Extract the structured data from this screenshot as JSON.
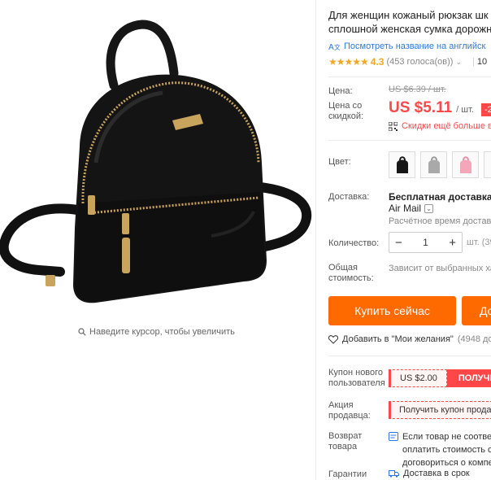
{
  "product": {
    "title_line1": "Для женщин кожаный рюкзак шк",
    "title_line2": "сплошной женская сумка дорожн",
    "translate_link": "Посмотреть название на английск",
    "rating_value": "4.3",
    "votes": "(453 голоса(ов))",
    "orders_count": "10"
  },
  "image": {
    "zoom_hint": "Наведите курсор, чтобы увеличить"
  },
  "price": {
    "label": "Цена:",
    "old_price": "US $6.39 / шт.",
    "discount_label": "Цена со скидкой:",
    "current_price": "US $5.11",
    "unit": "/ шт.",
    "discount_badge": "-2",
    "promo_text": "Скидки ещё больше в"
  },
  "options": {
    "color_label": "Цвет:",
    "colors": [
      "black-icon",
      "gray-icon",
      "pink-icon",
      "white-icon"
    ]
  },
  "shipping": {
    "label": "Доставка:",
    "title": "Бесплатная доставка в R",
    "method": "Air Mail",
    "estimate": "Расчётное время доставки"
  },
  "quantity": {
    "label": "Количество:",
    "value": "1",
    "minus": "−",
    "plus": "+",
    "available": "шт. (39"
  },
  "total": {
    "label": "Общая стоимость:",
    "value": "Зависит от выбранных хар"
  },
  "actions": {
    "buy_now": "Купить сейчас",
    "add_to_cart": "До",
    "wishlist": "Добавить в \"Мои желания\"",
    "wishlist_count": "(4948 до"
  },
  "coupons": {
    "new_user_label": "Купон нового пользователя",
    "new_user_value": "US $2.00",
    "new_user_action": "ПОЛУЧИ",
    "seller_label": "Акция продавца:",
    "seller_action": "Получить купон продав"
  },
  "policies": {
    "return_label": "Возврат товара",
    "return_line1": "Если товар не соответ",
    "return_line2": "оплатить стоимость об",
    "return_line3": "договориться о компе",
    "guarantee_label": "Гарантии",
    "guarantee_text": "Доставка в срок"
  },
  "colors": {
    "price_red": "#ff4747",
    "buy_orange": "#ff6a00",
    "link_blue": "#2a7ae2",
    "star_gold": "#f5a623"
  }
}
